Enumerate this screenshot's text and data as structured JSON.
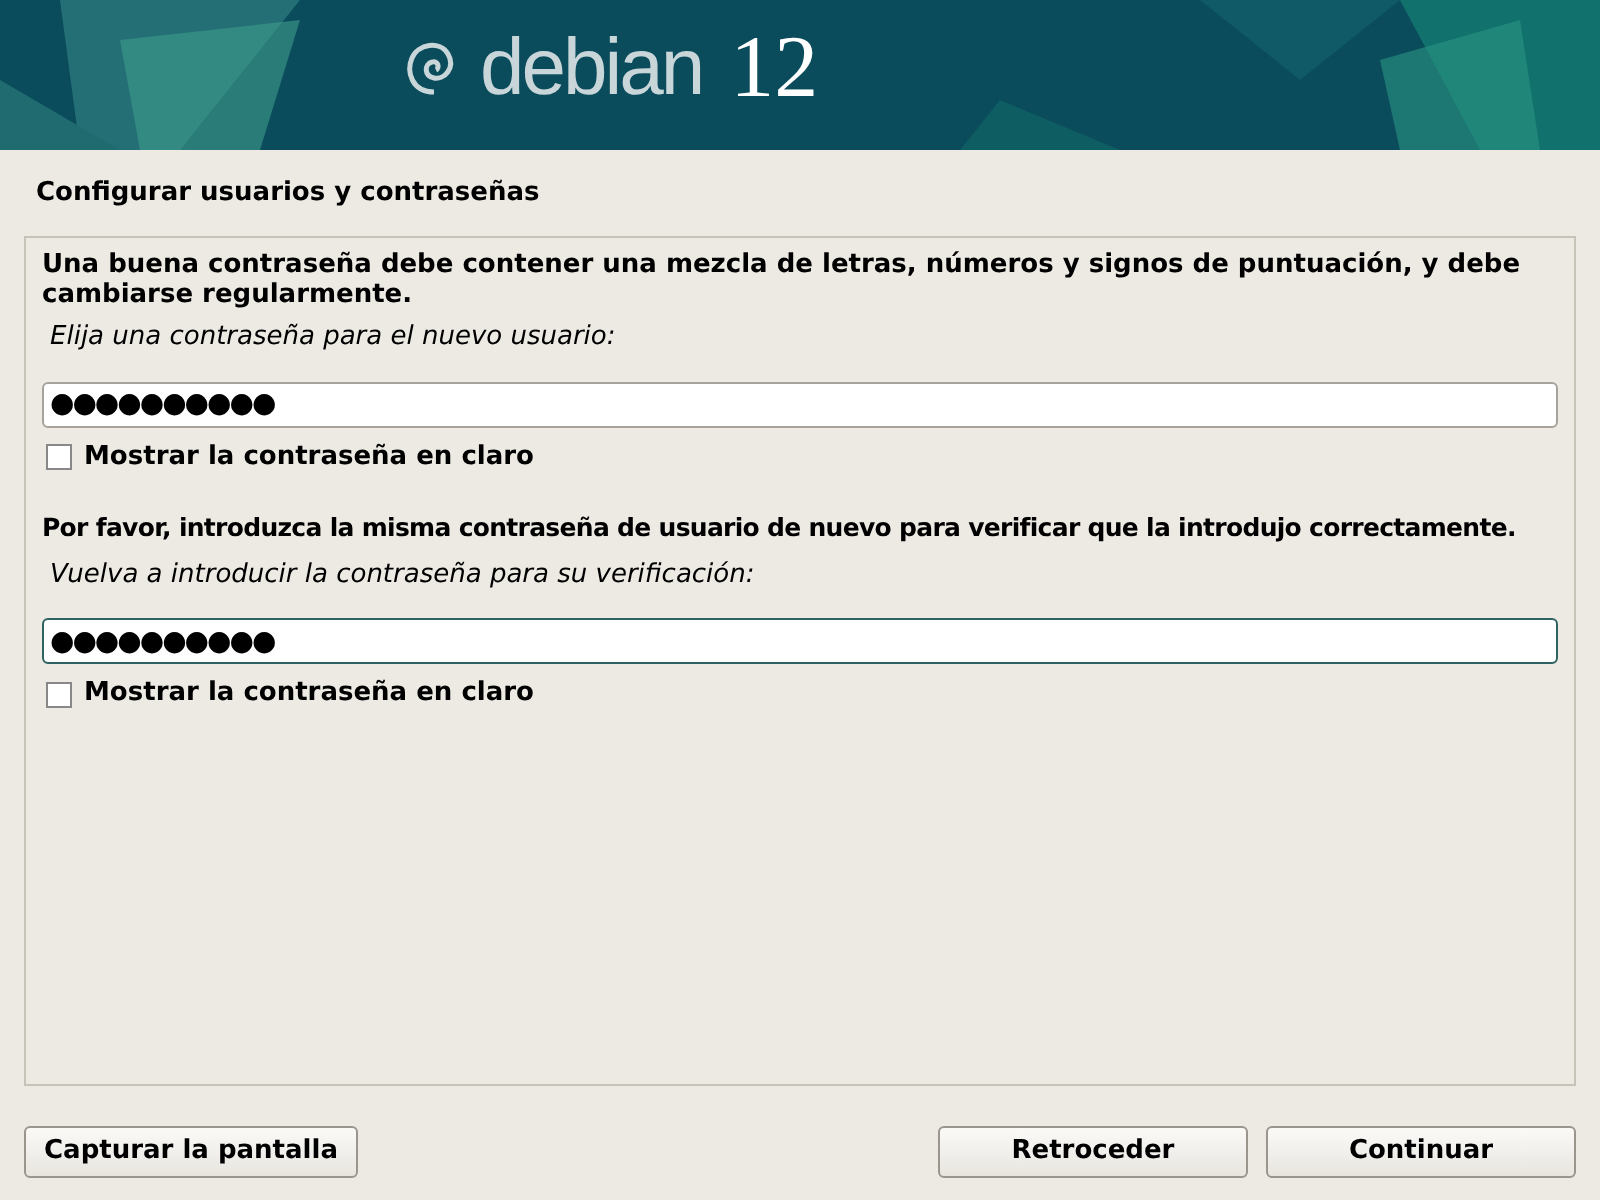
{
  "banner": {
    "logo_word": "debian",
    "version": "12"
  },
  "title": "Configurar usuarios y contraseñas",
  "description": "Una buena contraseña debe contener una mezcla de letras, números y signos de puntuación, y debe cambiarse regularmente.",
  "sections": [
    {
      "prompt": "Elija una contraseña para el nuevo usuario:",
      "value": "●●●●●●●●●●",
      "focused": false,
      "show_label": "Mostrar la contraseña en claro",
      "checked": false
    },
    {
      "intro": "Por favor, introduzca la misma contraseña de usuario de nuevo para verificar que la introdujo correctamente.",
      "prompt": "Vuelva a introducir la contraseña para su verificación:",
      "value": "●●●●●●●●●●",
      "focused": true,
      "show_label": "Mostrar la contraseña en claro",
      "checked": false
    }
  ],
  "buttons": {
    "left": "Capturar la pantalla",
    "back": "Retroceder",
    "next": "Continuar"
  }
}
